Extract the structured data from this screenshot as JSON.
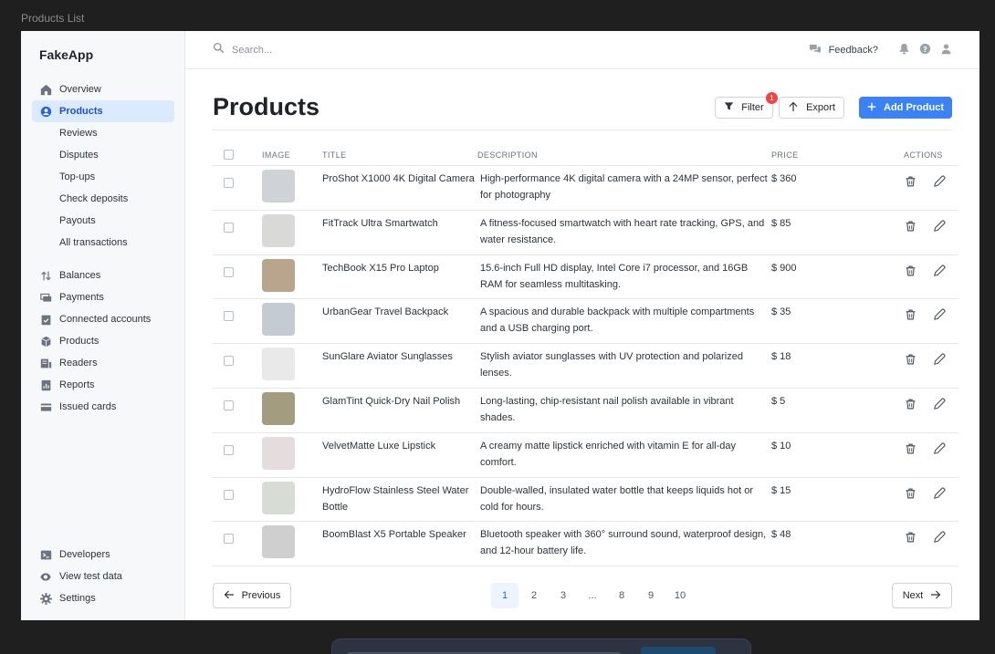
{
  "window_title": "Products List",
  "brand": "FakeApp",
  "sidebar": {
    "items": [
      {
        "label": "Overview",
        "icon": "home-icon"
      },
      {
        "label": "Products",
        "icon": "user-circle-icon",
        "active": true
      },
      {
        "label": "Reviews",
        "sub": true
      },
      {
        "label": "Disputes",
        "sub": true
      },
      {
        "label": "Top-ups",
        "sub": true
      },
      {
        "label": "Check deposits",
        "sub": true
      },
      {
        "label": "Payouts",
        "sub": true
      },
      {
        "label": "All transactions",
        "sub": true
      }
    ],
    "items2": [
      {
        "label": "Balances",
        "icon": "arrows-updown-icon"
      },
      {
        "label": "Payments",
        "icon": "payments-icon"
      },
      {
        "label": "Connected accounts",
        "icon": "clipboard-check-icon"
      },
      {
        "label": "Products",
        "icon": "cube-icon"
      },
      {
        "label": "Readers",
        "icon": "reader-icon"
      },
      {
        "label": "Reports",
        "icon": "report-icon"
      },
      {
        "label": "Issued cards",
        "icon": "card-icon"
      }
    ],
    "bottom": [
      {
        "label": "Developers",
        "icon": "terminal-icon"
      },
      {
        "label": "View test data",
        "icon": "eye-icon"
      },
      {
        "label": "Settings",
        "icon": "gear-icon"
      }
    ]
  },
  "topbar": {
    "search_placeholder": "Search...",
    "feedback_label": "Feedback?"
  },
  "page_title": "Products",
  "actions": {
    "filter_label": "Filter",
    "filter_badge": "1",
    "export_label": "Export",
    "add_label": "Add Product"
  },
  "table": {
    "headers": {
      "image": "IMAGE",
      "title": "TITLE",
      "description": "DESCRIPTION",
      "price": "PRICE",
      "actions": "ACTIONS"
    },
    "rows": [
      {
        "title": "ProShot X1000 4K Digital Camera",
        "description": "High-performance 4K digital camera with a 24MP sensor, perfect for photography",
        "price": "$ 360",
        "thumb": "#cfd2d6"
      },
      {
        "title": "FitTrack Ultra Smartwatch",
        "description": "A fitness-focused smartwatch with heart rate tracking, GPS, and water resistance.",
        "price": "$ 85",
        "thumb": "#d9d9d7"
      },
      {
        "title": "TechBook X15 Pro Laptop",
        "description": "15.6-inch Full HD display, Intel Core i7 processor, and 16GB RAM for seamless multitasking.",
        "price": "$ 900",
        "thumb": "#b9a48e"
      },
      {
        "title": "UrbanGear Travel Backpack",
        "description": "A spacious and durable backpack with multiple compartments and a USB charging port.",
        "price": "$ 35",
        "thumb": "#c5cbd3"
      },
      {
        "title": "SunGlare Aviator Sunglasses",
        "description": "Stylish aviator sunglasses with UV protection and polarized lenses.",
        "price": "$ 18",
        "thumb": "#e9e9e9"
      },
      {
        "title": "GlamTint Quick-Dry Nail Polish",
        "description": "Long-lasting, chip-resistant nail polish available in vibrant shades.",
        "price": "$ 5",
        "thumb": "#a39c7e"
      },
      {
        "title": "VelvetMatte Luxe Lipstick",
        "description": "A creamy matte lipstick enriched with vitamin E for all-day comfort.",
        "price": "$ 10",
        "thumb": "#e5dddd"
      },
      {
        "title": "HydroFlow Stainless Steel Water Bottle",
        "description": "Double-walled, insulated water bottle that keeps liquids hot or cold for hours.",
        "price": "$ 15",
        "thumb": "#d7dcd5"
      },
      {
        "title": "BoomBlast X5 Portable Speaker",
        "description": "Bluetooth speaker with 360° surround sound, waterproof design, and 12-hour battery life.",
        "price": "$ 48",
        "thumb": "#cfcfcf"
      }
    ]
  },
  "pagination": {
    "previous_label": "Previous",
    "next_label": "Next",
    "pages": [
      "1",
      "2",
      "3",
      "...",
      "8",
      "9",
      "10"
    ],
    "current": "1"
  },
  "colors": {
    "accent": "#3b82f6",
    "active_bg": "#dbeafe",
    "badge": "#ef4444"
  }
}
